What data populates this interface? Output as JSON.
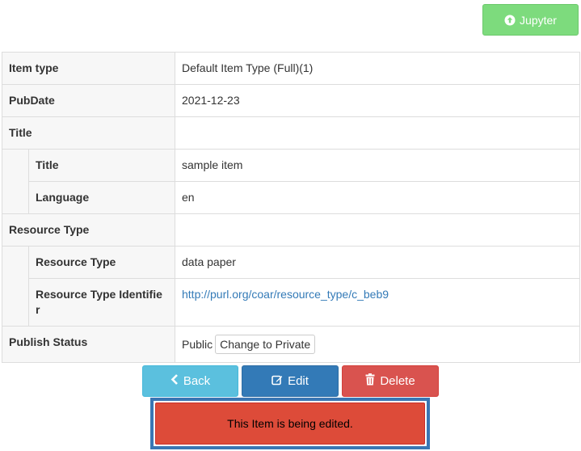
{
  "jupyter_button": {
    "label": "Jupyter",
    "icon": "arrow-circle-up-icon",
    "color": "#7ddb7d"
  },
  "metadata": {
    "item_type": {
      "key": "Item type",
      "value": "Default Item Type (Full)(1)"
    },
    "pubdate": {
      "key": "PubDate",
      "value": "2021-12-23"
    },
    "title_group": {
      "key": "Title",
      "title": {
        "key": "Title",
        "value": "sample item"
      },
      "language": {
        "key": "Language",
        "value": "en"
      }
    },
    "resource_group": {
      "key": "Resource Type",
      "resource_type": {
        "key": "Resource Type",
        "value": "data paper"
      },
      "resource_identifier": {
        "key_line1": "Resource Type Identifie",
        "key_line2": "r",
        "value": "http://purl.org/coar/resource_type/c_beb9"
      }
    },
    "publish_status": {
      "key": "Publish Status",
      "value": "Public",
      "change_label": "Change to Private"
    }
  },
  "actions": {
    "back_label": "Back",
    "edit_label": "Edit",
    "delete_label": "Delete",
    "colors": {
      "back": "#5bc0de",
      "edit": "#337ab7",
      "delete": "#d9534f"
    }
  },
  "alert": {
    "message": "This Item is being edited.",
    "color": "#dd4b39"
  }
}
